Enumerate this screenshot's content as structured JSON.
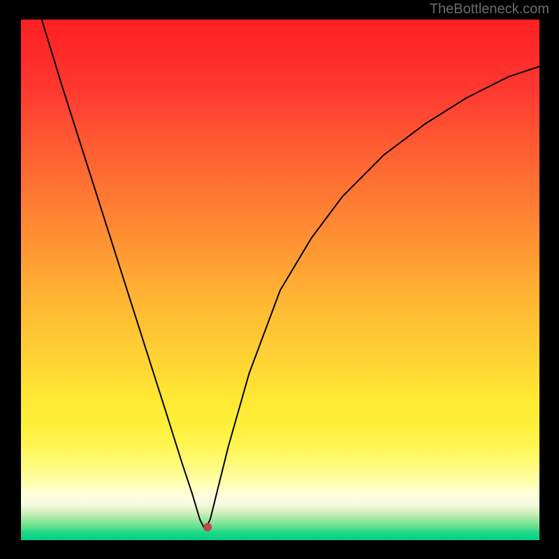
{
  "watermark": "TheBottleneck.com",
  "chart_data": {
    "type": "line",
    "title": "",
    "xlabel": "",
    "ylabel": "",
    "xlim": [
      0,
      100
    ],
    "ylim": [
      0,
      100
    ],
    "minimum_point": {
      "x": 35.5,
      "y": 2
    },
    "series": [
      {
        "name": "bottleneck-curve",
        "x": [
          4,
          8,
          12,
          16,
          20,
          24,
          28,
          31,
          33,
          34.5,
          35.5,
          36.5,
          38,
          40,
          44,
          50,
          56,
          62,
          70,
          78,
          86,
          94,
          100
        ],
        "y": [
          100,
          87,
          74.5,
          62,
          49.5,
          37,
          24.5,
          15,
          9,
          4,
          2,
          4,
          10,
          18,
          32,
          48,
          58,
          66,
          74,
          80,
          85,
          89,
          91
        ]
      }
    ],
    "marker": {
      "x": 36.0,
      "y": 2.5,
      "color": "#c04848"
    },
    "gradient_stops": [
      {
        "pos": 0,
        "color": "#ff2020"
      },
      {
        "pos": 50,
        "color": "#ffb033"
      },
      {
        "pos": 80,
        "color": "#fff653"
      },
      {
        "pos": 100,
        "color": "#00d084"
      }
    ]
  }
}
